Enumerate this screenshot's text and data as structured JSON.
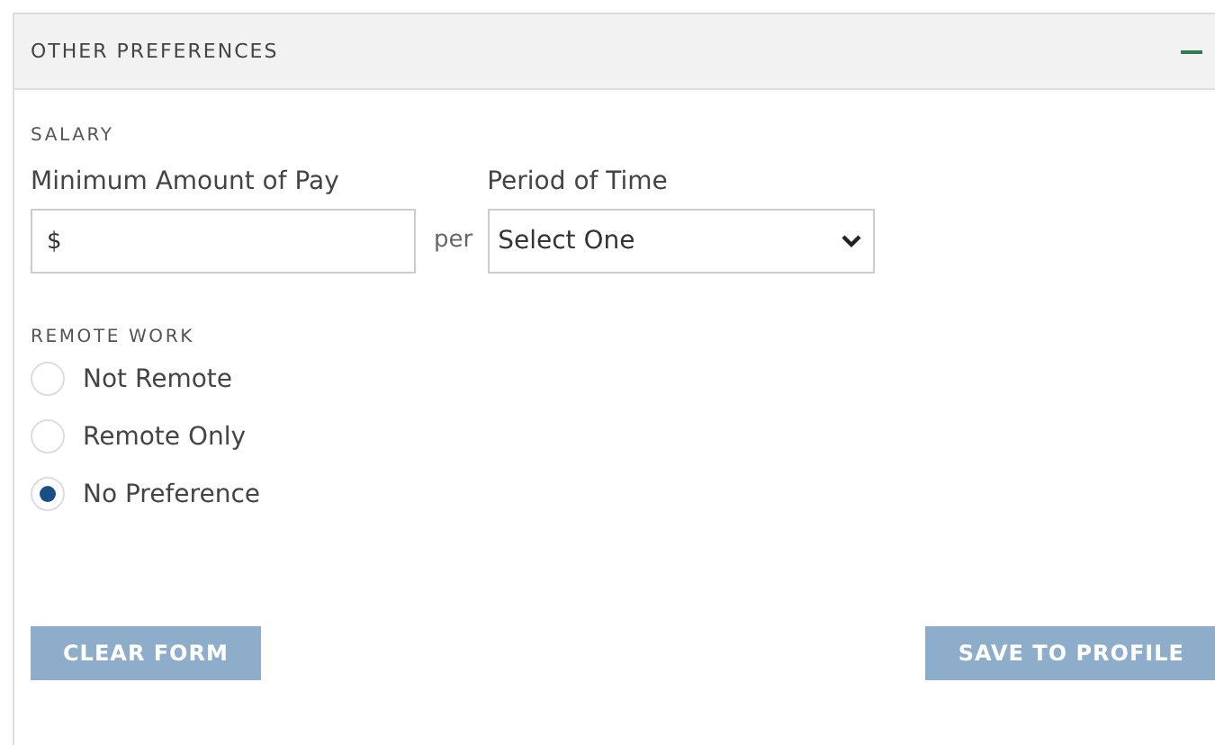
{
  "panel": {
    "title": "OTHER PREFERENCES",
    "expanded": true
  },
  "salary": {
    "heading": "SALARY",
    "amount_label": "Minimum Amount of Pay",
    "amount_value": "$",
    "per": "per",
    "period_label": "Period of Time",
    "period_value": "Select One"
  },
  "remote_work": {
    "heading": "REMOTE WORK",
    "options": [
      {
        "label": "Not Remote",
        "selected": false
      },
      {
        "label": "Remote Only",
        "selected": false
      },
      {
        "label": "No Preference",
        "selected": true
      }
    ]
  },
  "buttons": {
    "clear": "CLEAR FORM",
    "save": "SAVE TO PROFILE"
  }
}
